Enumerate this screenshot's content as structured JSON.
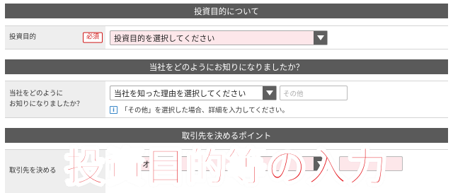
{
  "sections": {
    "purpose": {
      "header": "投資目的について",
      "label": "投資目的",
      "required_badge": "必須",
      "select_value": "投資目的を選択してください"
    },
    "referral": {
      "header": "当社をどのようにお知りになりましたか？",
      "label_line1": "当社をどのように",
      "label_line2": "お知りになりましたか？",
      "select_value": "当社を知った理由を選択してください",
      "other_placeholder": "その他",
      "note": "「その他」を選択した場合、詳細を入力してください。",
      "info_glyph": "i"
    },
    "deciding_point": {
      "header": "取引先を決めるポイント",
      "label": "取引先を決める",
      "select_value": "オ"
    }
  },
  "overlay": {
    "title": "投資目的等の入力"
  },
  "colors": {
    "header_bg": "#5a5a5a",
    "label_bg": "#eeeeee",
    "required_red": "#d01818",
    "select_pink": "#fde7ea",
    "overlay_red": "#e4151c",
    "info_blue": "#3a87c8"
  },
  "icons": {
    "select_arrow": "chevron-down-icon",
    "info": "info-icon"
  }
}
